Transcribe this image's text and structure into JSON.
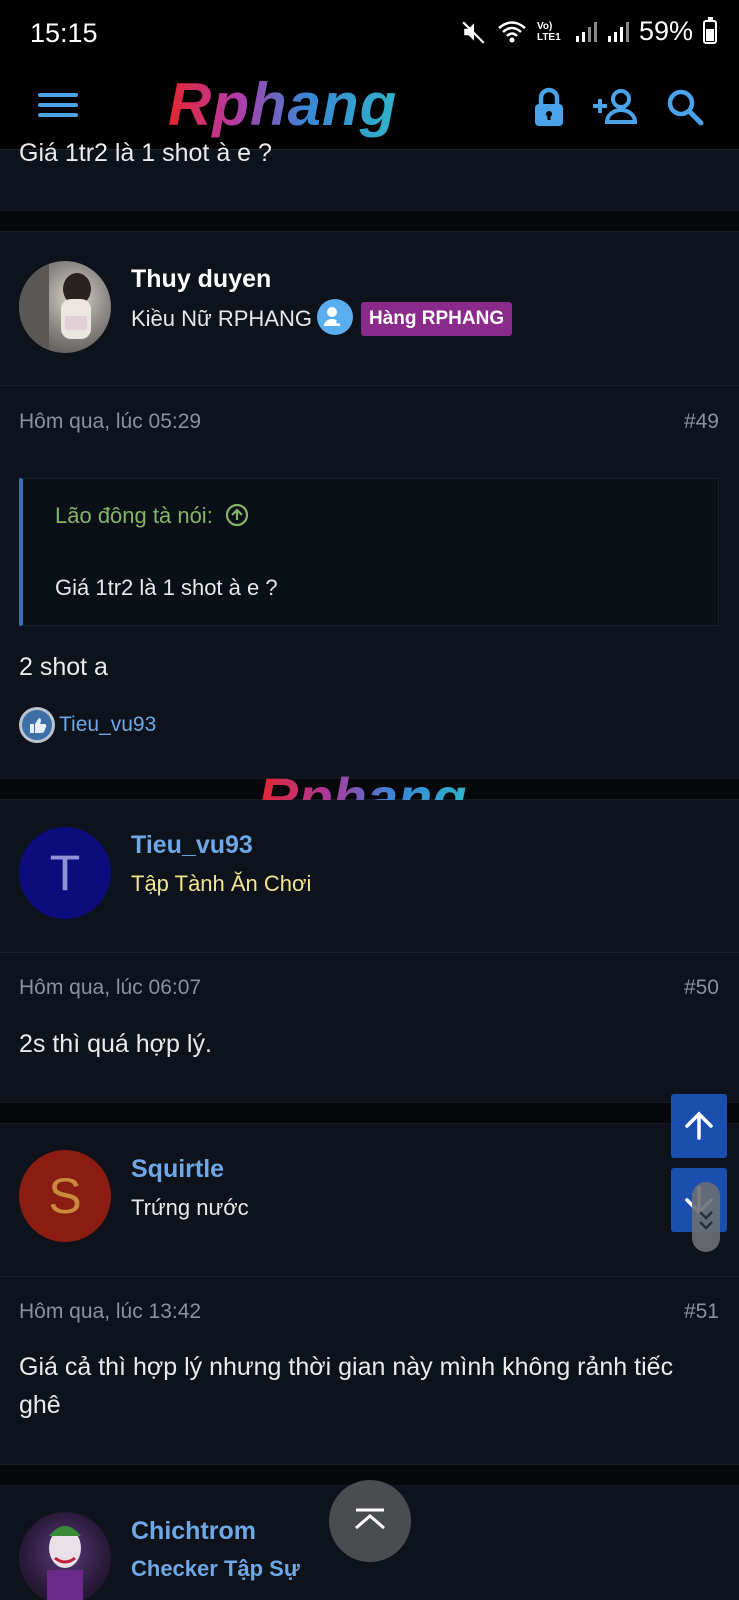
{
  "status": {
    "time": "15:15",
    "battery": "59%",
    "network": "Vo) LTE1"
  },
  "header": {
    "logo": "Rphang"
  },
  "prev_post": {
    "text": "Giá 1tr2 là 1 shot à e ?"
  },
  "posts": [
    {
      "author": "Thuy duyen",
      "title": "Kiều Nữ RPHANG",
      "badge": "Hàng RPHANG",
      "date": "Hôm qua, lúc 05:29",
      "number": "#49",
      "quote": {
        "author": "Lão đông tà nói:",
        "text": "Giá 1tr2 là 1 shot à e ?"
      },
      "body": "2 shot a",
      "likes": "Tieu_vu93"
    },
    {
      "author": "Tieu_vu93",
      "avatar_letter": "T",
      "title": "Tập Tành Ăn Chơi",
      "date": "Hôm qua, lúc 06:07",
      "number": "#50",
      "body": "2s thì quá hợp lý."
    },
    {
      "author": "Squirtle",
      "avatar_letter": "S",
      "title": "Trứng nước",
      "date": "Hôm qua, lúc 13:42",
      "number": "#51",
      "body": "Giá cả thì hợp lý nhưng thời gian này mình không rảnh tiếc ghê"
    },
    {
      "author": "Chichtrom",
      "title": "Checker Tập Sự"
    }
  ],
  "watermark": "Rphang",
  "colors": {
    "accent": "#4aa3e8",
    "link": "#6ea8e6",
    "badge": "#8a2a8a",
    "title_yellow": "#f0e68c"
  }
}
